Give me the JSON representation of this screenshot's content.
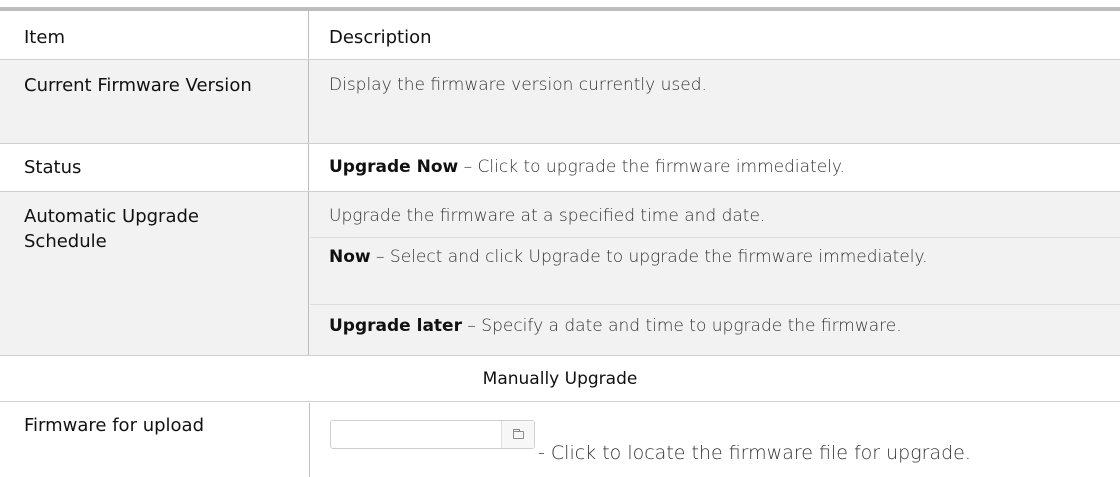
{
  "table": {
    "header": {
      "item": "Item",
      "description": "Description"
    },
    "rows": [
      {
        "item": "Current Firmware Version",
        "desc": [
          {
            "bold": "",
            "text": "Display the firmware version currently used."
          }
        ]
      },
      {
        "item": "Status",
        "desc": [
          {
            "bold": "Upgrade Now",
            "text": " – Click to upgrade the firmware immediately."
          }
        ]
      },
      {
        "item": "Automatic Upgrade Schedule",
        "desc": [
          {
            "bold": "",
            "text": "Upgrade the firmware at a specified time and date."
          },
          {
            "bold": "Now",
            "text": " – Select and click Upgrade to upgrade the firmware immediately."
          },
          {
            "bold": "Upgrade later",
            "text": " – Specify a date and time to upgrade the firmware."
          }
        ]
      }
    ],
    "section_title": "Manually Upgrade",
    "upload_row": {
      "item": "Firmware for upload",
      "file_value": "",
      "text": "- Click to locate the firmware file for upgrade."
    }
  },
  "icons": {
    "browse": "folder-icon"
  },
  "colors": {
    "header_bg": "#ffffff",
    "row_gray": "#f2f2f2",
    "divider": "#bdbdbd"
  }
}
